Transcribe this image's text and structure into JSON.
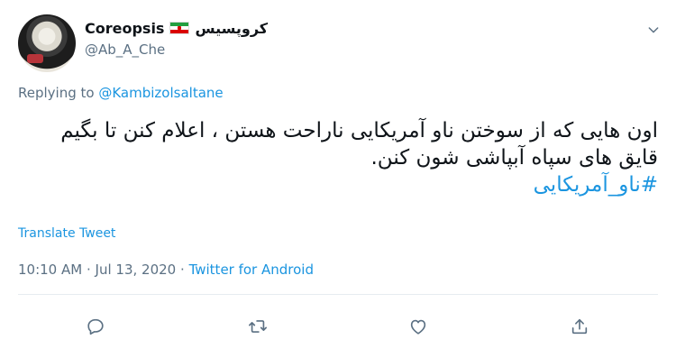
{
  "header": {
    "display_name": "Coreopsis",
    "persian_name": "کروپسیس",
    "handle": "@Ab_A_Che",
    "flag_icon": "iran-flag-icon",
    "menu_icon": "chevron-down-icon"
  },
  "reply": {
    "prefix": "Replying to",
    "mention": "@Kambizolsaltane"
  },
  "tweet": {
    "text": "اون هایی که از سوختن ناو آمریکایی ناراحت هستن ، اعلام کنن تا بگیم قایق های سپاه آبپاشی شون کنن.",
    "hashtag": "#ناو_آمریکایی"
  },
  "translate_label": "Translate Tweet",
  "meta": {
    "time": "10:10 AM",
    "separator1": "·",
    "date": "Jul 13, 2020",
    "separator2": "·",
    "source": "Twitter for Android"
  },
  "actions": [
    {
      "name": "reply-icon"
    },
    {
      "name": "retweet-icon"
    },
    {
      "name": "like-icon"
    },
    {
      "name": "share-icon"
    }
  ],
  "colors": {
    "link": "#1b95e0",
    "secondary": "#5b7083",
    "text": "#0f1419"
  }
}
